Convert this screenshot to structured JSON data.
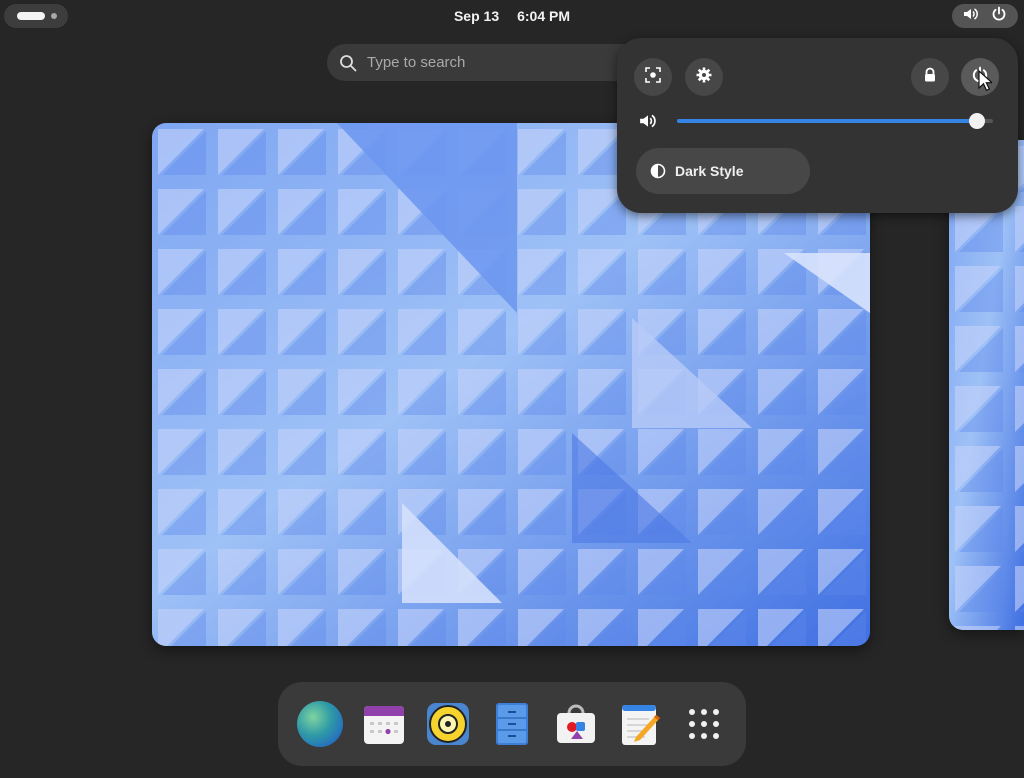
{
  "topbar": {
    "date": "Sep 13",
    "time": "6:04 PM"
  },
  "search": {
    "placeholder": "Type to search"
  },
  "quick_settings": {
    "volume_level": 0.95,
    "dark_style_label": "Dark Style"
  },
  "dash": {
    "apps": [
      "web-browser",
      "calendar",
      "rhythmbox",
      "files",
      "software",
      "text-editor",
      "show-apps"
    ]
  },
  "colors": {
    "accent": "#3584e4",
    "wallpaper_base": "#6a93ee"
  }
}
